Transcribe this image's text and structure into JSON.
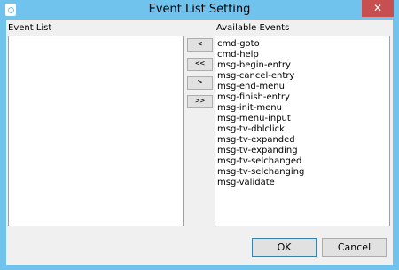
{
  "window": {
    "title": "Event List Setting",
    "close_glyph": "✕"
  },
  "event_list": {
    "label": "Event List",
    "items": []
  },
  "available_events": {
    "label": "Available Events",
    "items": [
      "cmd-goto",
      "cmd-help",
      "msg-begin-entry",
      "msg-cancel-entry",
      "msg-end-menu",
      "msg-finish-entry",
      "msg-init-menu",
      "msg-menu-input",
      "msg-tv-dblclick",
      "msg-tv-expanded",
      "msg-tv-expanding",
      "msg-tv-selchanged",
      "msg-tv-selchanging",
      "msg-validate"
    ]
  },
  "move_buttons": {
    "add_one": "<",
    "add_all": "<<",
    "remove_one": ">",
    "remove_all": ">>"
  },
  "buttons": {
    "ok": "OK",
    "cancel": "Cancel"
  }
}
